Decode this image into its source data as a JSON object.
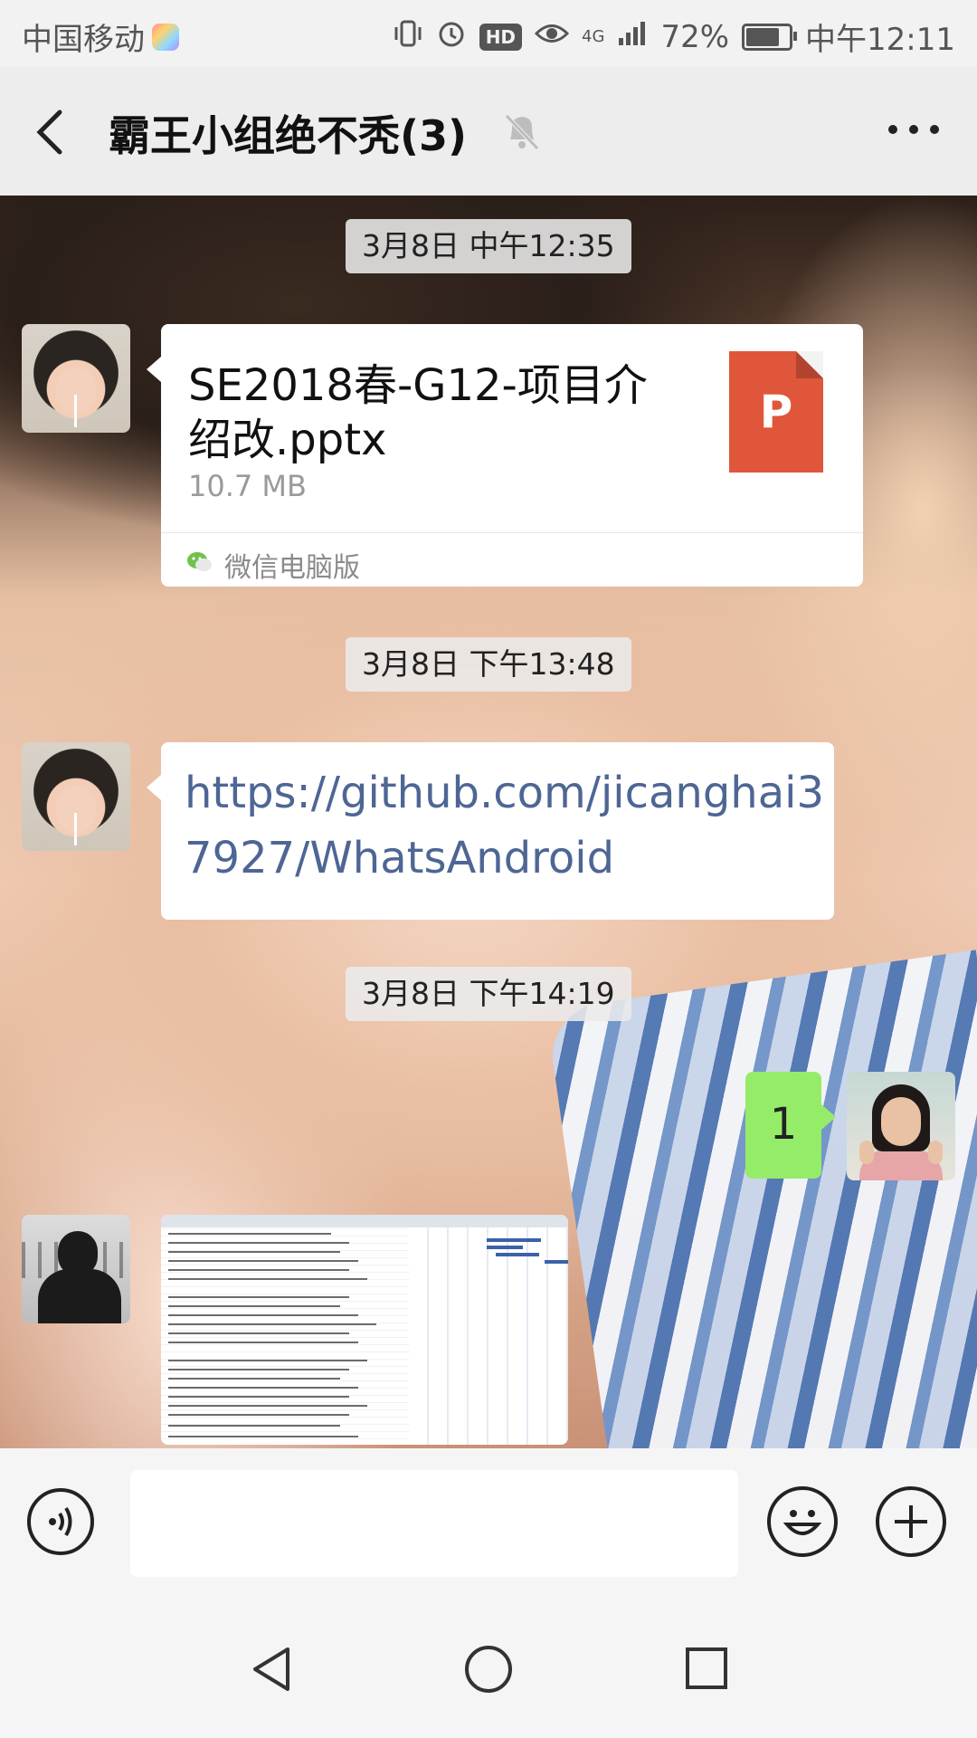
{
  "status_bar": {
    "carrier": "中国移动",
    "network": "4G",
    "battery": "72%",
    "battery_level": 0.72,
    "time": "中午12:11",
    "icons": [
      "vibrate-icon",
      "alarm-icon",
      "hd-icon",
      "eye-icon",
      "signal-icon",
      "battery-icon"
    ]
  },
  "header": {
    "title": "霸王小组绝不秃(3)",
    "back_icon": "chevron-left-icon",
    "mute_icon": "bell-off-icon",
    "more_icon": "more-icon"
  },
  "messages": {
    "timestamp1": "3月8日 中午12:35",
    "file_msg": {
      "name": "SE2018春-G12-项目介绍改.pptx",
      "size": "10.7 MB",
      "type_letter": "P",
      "source": "微信电脑版"
    },
    "timestamp2": "3月8日 下午13:48",
    "link_msg": {
      "text": "https://github.com/jicanghai37927/WhatsAndroid"
    },
    "timestamp3": "3月8日 下午14:19",
    "sent_msg": {
      "text": "1"
    },
    "image_msg": {
      "description_icon": "spreadsheet-image"
    }
  },
  "input_bar": {
    "placeholder": "",
    "value": "",
    "voice_icon": "voice-icon",
    "emoji_icon": "emoji-icon",
    "plus_icon": "plus-icon"
  },
  "nav_bar": {
    "icons": [
      "nav-back-icon",
      "nav-home-icon",
      "nav-recent-icon"
    ]
  },
  "colors": {
    "link": "#4e6694",
    "sent_bubble": "#95ec69",
    "ppt_icon": "#e0563a"
  }
}
